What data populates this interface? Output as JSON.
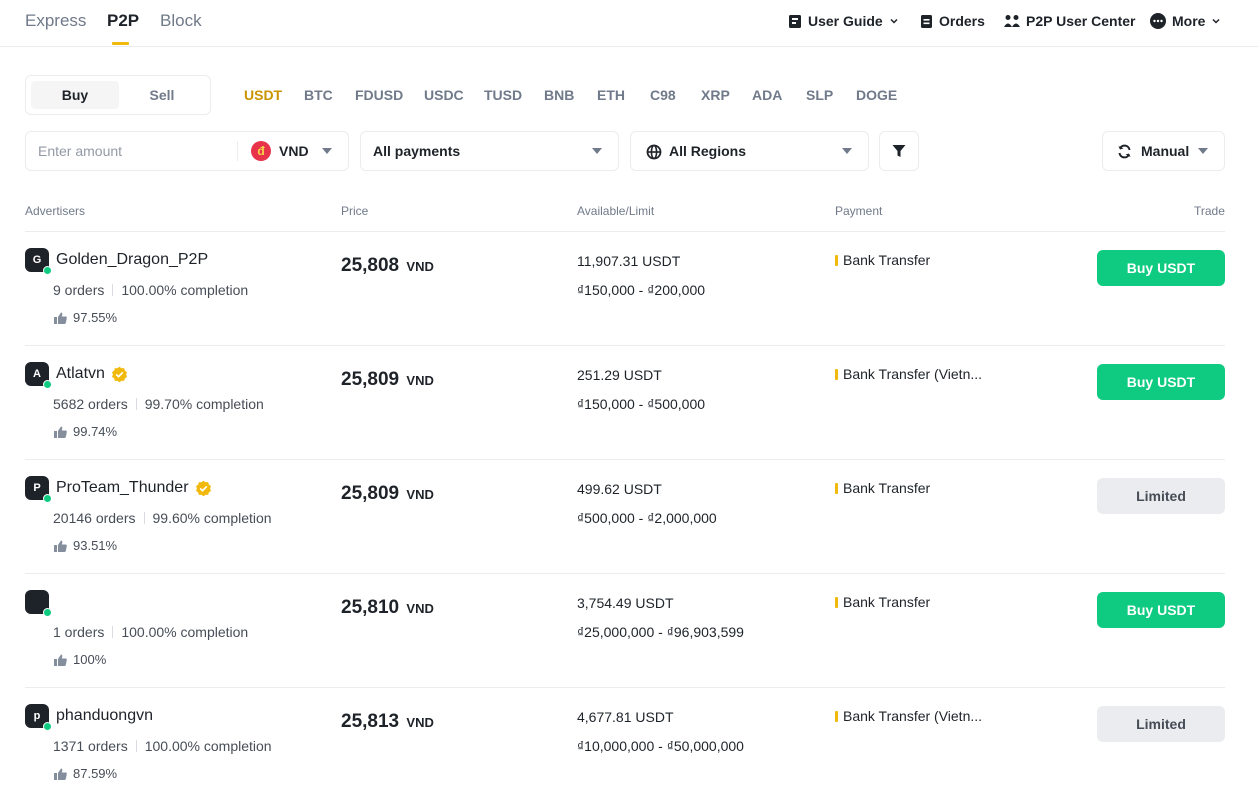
{
  "nav": {
    "tabs": [
      {
        "label": "Express"
      },
      {
        "label": "P2P",
        "active": true
      },
      {
        "label": "Block"
      }
    ],
    "links": {
      "user_guide": "User Guide",
      "orders": "Orders",
      "user_center": "P2P User Center",
      "more": "More"
    }
  },
  "toggle": {
    "buy": "Buy",
    "sell": "Sell",
    "selected": "Buy"
  },
  "coins": [
    "USDT",
    "BTC",
    "FDUSD",
    "USDC",
    "TUSD",
    "BNB",
    "ETH",
    "C98",
    "XRP",
    "ADA",
    "SLP",
    "DOGE"
  ],
  "selected_coin": "USDT",
  "filters": {
    "amount_placeholder": "Enter amount",
    "fiat": "VND",
    "fiat_icon_glyph": "đ",
    "payments": "All payments",
    "regions": "All Regions",
    "refresh": "Manual"
  },
  "table": {
    "headers": {
      "advertisers": "Advertisers",
      "price": "Price",
      "available": "Available/Limit",
      "payment": "Payment",
      "trade": "Trade"
    },
    "rows": [
      {
        "initial": "G",
        "name": "Golden_Dragon_P2P",
        "verified": false,
        "orders": "9 orders",
        "completion": "100.00% completion",
        "rating": "97.55%",
        "price": "25,808",
        "currency": "VND",
        "available": "11,907.31 USDT",
        "limit": "₫150,000 - ₫200,000",
        "payment": "Bank Transfer",
        "action": "Buy USDT",
        "action_type": "buy"
      },
      {
        "initial": "A",
        "name": "Atlatvn",
        "verified": true,
        "orders": "5682 orders",
        "completion": "99.70% completion",
        "rating": "99.74%",
        "price": "25,809",
        "currency": "VND",
        "available": "251.29 USDT",
        "limit": "₫150,000 - ₫500,000",
        "payment": "Bank Transfer (Vietn...",
        "action": "Buy USDT",
        "action_type": "buy"
      },
      {
        "initial": "P",
        "name": "ProTeam_Thunder",
        "verified": true,
        "orders": "20146 orders",
        "completion": "99.60% completion",
        "rating": "93.51%",
        "price": "25,809",
        "currency": "VND",
        "available": "499.62 USDT",
        "limit": "₫500,000 - ₫2,000,000",
        "payment": "Bank Transfer",
        "action": "Limited",
        "action_type": "limited"
      },
      {
        "initial": "",
        "name": "",
        "verified": false,
        "orders": "1 orders",
        "completion": "100.00% completion",
        "rating": "100%",
        "price": "25,810",
        "currency": "VND",
        "available": "3,754.49 USDT",
        "limit": "₫25,000,000 - ₫96,903,599",
        "payment": "Bank Transfer",
        "action": "Buy USDT",
        "action_type": "buy"
      },
      {
        "initial": "p",
        "name": "phanduongvn",
        "verified": false,
        "orders": "1371 orders",
        "completion": "100.00% completion",
        "rating": "87.59%",
        "price": "25,813",
        "currency": "VND",
        "available": "4,677.81 USDT",
        "limit": "₫10,000,000 - ₫50,000,000",
        "payment": "Bank Transfer (Vietn...",
        "action": "Limited",
        "action_type": "limited"
      }
    ]
  },
  "colors": {
    "accent": "#f0b90b",
    "buy": "#0ecb81",
    "limited": "#eaecef",
    "text": "#1e2329",
    "muted": "#707a8a"
  }
}
